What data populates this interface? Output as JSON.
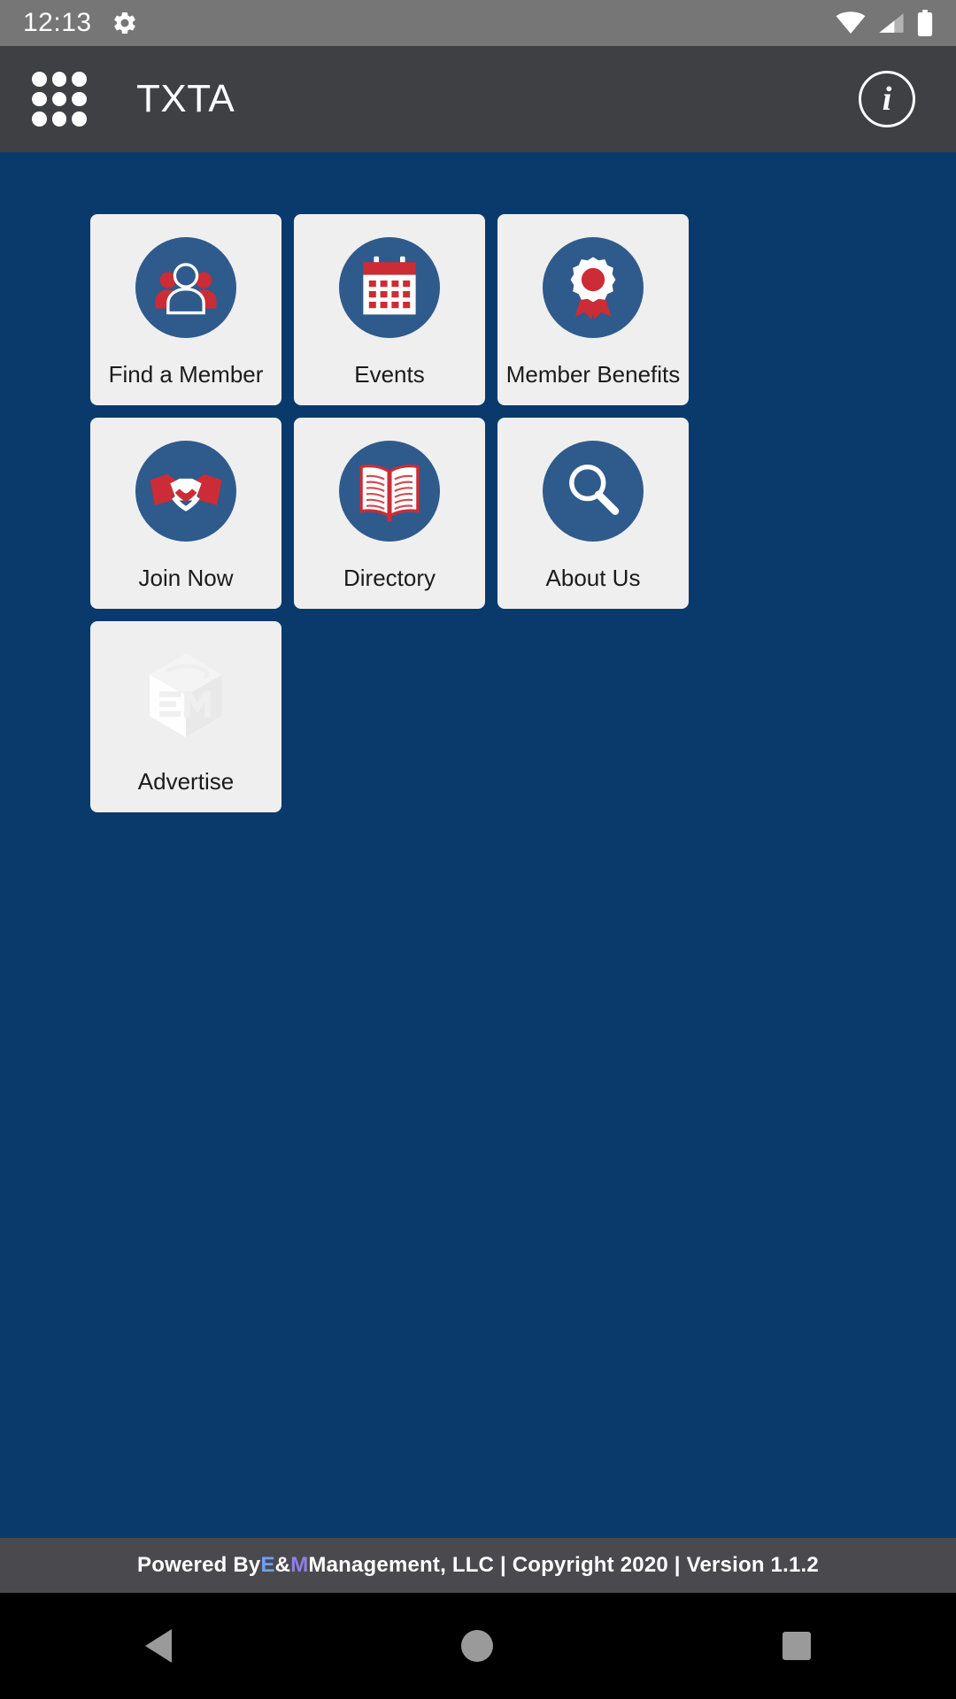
{
  "status_bar": {
    "time": "12:13",
    "icons": [
      "gear-icon",
      "wifi-icon",
      "cell-signal-icon",
      "battery-icon"
    ],
    "background": "#767676"
  },
  "app_bar": {
    "menu_icon": "grid-dots-menu-icon",
    "title": "TXTA",
    "info_label": "i",
    "background": "#3f4044"
  },
  "theme": {
    "page_background": "#0a3a6b",
    "tile_background": "#efefef",
    "icon_circle": "#2f5a8c",
    "accent_red": "#cc2c35",
    "footer_background": "#4a4a4e"
  },
  "tiles": [
    {
      "label": "Find a Member",
      "icon": "people-group-icon"
    },
    {
      "label": "Events",
      "icon": "calendar-icon"
    },
    {
      "label": "Member Benefits",
      "icon": "award-ribbon-icon"
    },
    {
      "label": "Join Now",
      "icon": "handshake-icon"
    },
    {
      "label": "Directory",
      "icon": "open-book-icon"
    },
    {
      "label": "About Us",
      "icon": "magnifying-glass-icon"
    },
    {
      "label": "Advertise",
      "icon": "em-cube-logo-icon"
    }
  ],
  "footer": {
    "prefix": "Powered By ",
    "brand_e": "E",
    "brand_amp": "&",
    "brand_m": "M",
    "suffix": " Management, LLC | Copyright 2020 | Version 1.1.2"
  },
  "nav_bar": {
    "back": "back-triangle",
    "home": "home-circle",
    "recents": "recents-square"
  }
}
